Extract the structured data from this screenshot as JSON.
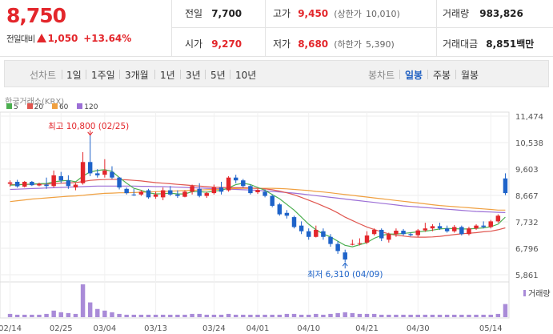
{
  "header": {
    "price": "8,750",
    "change_label": "전일대비",
    "change_amount": "1,050",
    "change_percent": "+13.64%"
  },
  "quote": {
    "prev_close": {
      "label": "전일",
      "value": "7,700"
    },
    "open": {
      "label": "시가",
      "value": "9,270"
    },
    "high": {
      "label": "고가",
      "value": "9,450",
      "sub_label": "(상한가",
      "sub_value": "10,010)"
    },
    "low": {
      "label": "저가",
      "value": "8,680",
      "sub_label": "(하한가",
      "sub_value": "5,390)"
    },
    "volume": {
      "label": "거래량",
      "value": "983,826"
    },
    "amount": {
      "label": "거래대금",
      "value": "8,851",
      "unit": "백만"
    }
  },
  "tabs": {
    "chart_type_label": "선차트",
    "periods": [
      "1일",
      "1주일",
      "3개월",
      "1년",
      "3년",
      "5년",
      "10년"
    ],
    "candle_label": "봉차트",
    "candles": [
      "일봉",
      "주봉",
      "월봉"
    ],
    "active_candle": "일봉"
  },
  "colors": {
    "up": "#e3262b",
    "down": "#1e63c9",
    "ma5": "#4caf50",
    "ma20": "#e0564f",
    "ma60": "#f0a040",
    "ma120": "#9c6fd6"
  },
  "chart_data": {
    "type": "candlestick",
    "title": "한국거래소(KRX)",
    "legend": [
      {
        "name": "5",
        "color": "#4caf50"
      },
      {
        "name": "20",
        "color": "#e0564f"
      },
      {
        "name": "60",
        "color": "#f0a040"
      },
      {
        "name": "120",
        "color": "#9c6fd6"
      }
    ],
    "yticks": [
      "11,474",
      "10,538",
      "9,603",
      "8,667",
      "7,732",
      "6,796",
      "5,861"
    ],
    "ylim": [
      5861,
      11474
    ],
    "xticks": [
      "02/14",
      "02/25",
      "03/04",
      "03/13",
      "03/24",
      "04/01",
      "04/10",
      "04/21",
      "04/30",
      "05/14"
    ],
    "high_annotation": "최고 10,800 (02/25)",
    "low_annotation": "최저 6,310 (04/09)",
    "volume_label": "거래량",
    "candles": [
      {
        "o": 9080,
        "h": 9200,
        "l": 8980,
        "c": 9130
      },
      {
        "o": 9150,
        "h": 9220,
        "l": 8940,
        "c": 8990
      },
      {
        "o": 8980,
        "h": 9180,
        "l": 8950,
        "c": 9150
      },
      {
        "o": 9150,
        "h": 9180,
        "l": 9000,
        "c": 9030
      },
      {
        "o": 9020,
        "h": 9120,
        "l": 8990,
        "c": 9080
      },
      {
        "o": 9050,
        "h": 9300,
        "l": 8900,
        "c": 9000
      },
      {
        "o": 9000,
        "h": 9550,
        "l": 8950,
        "c": 9380
      },
      {
        "o": 9350,
        "h": 9500,
        "l": 9100,
        "c": 9200
      },
      {
        "o": 9200,
        "h": 9380,
        "l": 8900,
        "c": 9000
      },
      {
        "o": 8950,
        "h": 9100,
        "l": 8850,
        "c": 9050
      },
      {
        "o": 9100,
        "h": 10200,
        "l": 9050,
        "c": 9850
      },
      {
        "o": 9850,
        "h": 10800,
        "l": 9350,
        "c": 9450
      },
      {
        "o": 9450,
        "h": 9600,
        "l": 9300,
        "c": 9380
      },
      {
        "o": 9400,
        "h": 9950,
        "l": 9300,
        "c": 9550
      },
      {
        "o": 9500,
        "h": 9700,
        "l": 9250,
        "c": 9300
      },
      {
        "o": 9300,
        "h": 9320,
        "l": 8880,
        "c": 8950
      },
      {
        "o": 8900,
        "h": 8950,
        "l": 8700,
        "c": 8750
      },
      {
        "o": 8700,
        "h": 8900,
        "l": 8650,
        "c": 8680
      },
      {
        "o": 8700,
        "h": 8850,
        "l": 8650,
        "c": 8800
      },
      {
        "o": 8850,
        "h": 8900,
        "l": 8550,
        "c": 8600
      },
      {
        "o": 8620,
        "h": 8800,
        "l": 8550,
        "c": 8700
      },
      {
        "o": 8600,
        "h": 8950,
        "l": 8500,
        "c": 8850
      },
      {
        "o": 8850,
        "h": 9000,
        "l": 8650,
        "c": 8700
      },
      {
        "o": 8700,
        "h": 8850,
        "l": 8580,
        "c": 8650
      },
      {
        "o": 8620,
        "h": 8850,
        "l": 8600,
        "c": 8800
      },
      {
        "o": 8800,
        "h": 9050,
        "l": 8700,
        "c": 9000
      },
      {
        "o": 8900,
        "h": 9100,
        "l": 8600,
        "c": 8650
      },
      {
        "o": 8650,
        "h": 8800,
        "l": 8580,
        "c": 8750
      },
      {
        "o": 8750,
        "h": 9050,
        "l": 8700,
        "c": 8950
      },
      {
        "o": 8950,
        "h": 9150,
        "l": 8700,
        "c": 8800
      },
      {
        "o": 8850,
        "h": 9350,
        "l": 8800,
        "c": 9300
      },
      {
        "o": 9300,
        "h": 9400,
        "l": 9100,
        "c": 9200
      },
      {
        "o": 9200,
        "h": 9250,
        "l": 8950,
        "c": 9000
      },
      {
        "o": 9000,
        "h": 9050,
        "l": 8700,
        "c": 8750
      },
      {
        "o": 8780,
        "h": 8900,
        "l": 8720,
        "c": 8860
      },
      {
        "o": 8800,
        "h": 8880,
        "l": 8600,
        "c": 8650
      },
      {
        "o": 8650,
        "h": 8700,
        "l": 8250,
        "c": 8300
      },
      {
        "o": 8350,
        "h": 8400,
        "l": 7950,
        "c": 8000
      },
      {
        "o": 8050,
        "h": 8150,
        "l": 7850,
        "c": 7950
      },
      {
        "o": 7900,
        "h": 7950,
        "l": 7500,
        "c": 7550
      },
      {
        "o": 7600,
        "h": 7750,
        "l": 7300,
        "c": 7400
      },
      {
        "o": 7400,
        "h": 7500,
        "l": 7100,
        "c": 7200
      },
      {
        "o": 7200,
        "h": 7600,
        "l": 7180,
        "c": 7450
      },
      {
        "o": 7400,
        "h": 7500,
        "l": 7100,
        "c": 7200
      },
      {
        "o": 7200,
        "h": 7300,
        "l": 6850,
        "c": 6950
      },
      {
        "o": 6950,
        "h": 7050,
        "l": 6600,
        "c": 6700
      },
      {
        "o": 6650,
        "h": 6750,
        "l": 6310,
        "c": 6400
      },
      {
        "o": 6950,
        "h": 7100,
        "l": 6900,
        "c": 6950
      },
      {
        "o": 6980,
        "h": 7150,
        "l": 6900,
        "c": 6980
      },
      {
        "o": 7000,
        "h": 7400,
        "l": 6950,
        "c": 7250
      },
      {
        "o": 7300,
        "h": 7500,
        "l": 7250,
        "c": 7450
      },
      {
        "o": 7450,
        "h": 7500,
        "l": 7050,
        "c": 7150
      },
      {
        "o": 7100,
        "h": 7350,
        "l": 7000,
        "c": 7300
      },
      {
        "o": 7300,
        "h": 7500,
        "l": 7200,
        "c": 7420
      },
      {
        "o": 7420,
        "h": 7480,
        "l": 7250,
        "c": 7300
      },
      {
        "o": 7300,
        "h": 7350,
        "l": 7220,
        "c": 7260
      },
      {
        "o": 7260,
        "h": 7480,
        "l": 7200,
        "c": 7430
      },
      {
        "o": 7430,
        "h": 7700,
        "l": 7380,
        "c": 7500
      },
      {
        "o": 7500,
        "h": 7650,
        "l": 7400,
        "c": 7580
      },
      {
        "o": 7580,
        "h": 7700,
        "l": 7450,
        "c": 7500
      },
      {
        "o": 7500,
        "h": 7600,
        "l": 7350,
        "c": 7400
      },
      {
        "o": 7400,
        "h": 7620,
        "l": 7350,
        "c": 7550
      },
      {
        "o": 7550,
        "h": 7600,
        "l": 7250,
        "c": 7300
      },
      {
        "o": 7300,
        "h": 7560,
        "l": 7250,
        "c": 7500
      },
      {
        "o": 7500,
        "h": 7650,
        "l": 7450,
        "c": 7600
      },
      {
        "o": 7600,
        "h": 7750,
        "l": 7500,
        "c": 7550
      },
      {
        "o": 7550,
        "h": 7800,
        "l": 7500,
        "c": 7750
      },
      {
        "o": 7750,
        "h": 8000,
        "l": 7700,
        "c": 7950
      },
      {
        "o": 9270,
        "h": 9450,
        "l": 8680,
        "c": 8750
      }
    ],
    "volume": [
      4,
      3,
      3,
      3,
      3,
      4,
      8,
      6,
      5,
      4,
      40,
      18,
      10,
      8,
      6,
      4,
      3,
      3,
      3,
      3,
      3,
      3,
      3,
      3,
      3,
      4,
      4,
      3,
      3,
      3,
      4,
      3,
      3,
      3,
      3,
      3,
      3,
      3,
      4,
      4,
      3,
      3,
      4,
      3,
      4,
      5,
      6,
      5,
      4,
      4,
      4,
      3,
      3,
      3,
      3,
      3,
      3,
      3,
      3,
      3,
      3,
      3,
      3,
      3,
      3,
      3,
      3,
      4,
      16
    ],
    "ma5": [
      9030,
      9040,
      9060,
      9070,
      9080,
      9090,
      9150,
      9180,
      9200,
      9150,
      9350,
      9500,
      9550,
      9580,
      9520,
      9300,
      9100,
      8920,
      8850,
      8760,
      8720,
      8730,
      8750,
      8720,
      8720,
      8800,
      8800,
      8780,
      8820,
      8850,
      8930,
      9050,
      9100,
      9050,
      8950,
      8850,
      8700,
      8550,
      8350,
      8150,
      7900,
      7650,
      7450,
      7300,
      7200,
      7050,
      6900,
      6850,
      6920,
      7000,
      7150,
      7250,
      7300,
      7300,
      7320,
      7350,
      7380,
      7400,
      7440,
      7480,
      7500,
      7490,
      7480,
      7480,
      7500,
      7520,
      7560,
      7650,
      7900
    ],
    "ma20": [
      9050,
      9050,
      9060,
      9060,
      9070,
      9070,
      9080,
      9100,
      9110,
      9120,
      9160,
      9200,
      9220,
      9230,
      9240,
      9230,
      9220,
      9200,
      9180,
      9150,
      9120,
      9100,
      9080,
      9060,
      9040,
      9020,
      9000,
      8980,
      8960,
      8950,
      8940,
      8940,
      8940,
      8930,
      8920,
      8900,
      8870,
      8820,
      8760,
      8690,
      8600,
      8500,
      8400,
      8290,
      8180,
      8050,
      7900,
      7780,
      7660,
      7550,
      7460,
      7380,
      7310,
      7260,
      7230,
      7200,
      7190,
      7190,
      7200,
      7220,
      7250,
      7280,
      7310,
      7330,
      7350,
      7380,
      7400,
      7450,
      7520
    ],
    "ma60": [
      8450,
      8480,
      8510,
      8540,
      8560,
      8580,
      8600,
      8620,
      8640,
      8650,
      8670,
      8700,
      8720,
      8740,
      8750,
      8760,
      8760,
      8770,
      8780,
      8790,
      8800,
      8810,
      8820,
      8830,
      8840,
      8850,
      8860,
      8870,
      8880,
      8890,
      8900,
      8910,
      8920,
      8920,
      8920,
      8920,
      8920,
      8910,
      8900,
      8880,
      8860,
      8840,
      8810,
      8790,
      8760,
      8730,
      8700,
      8670,
      8640,
      8610,
      8580,
      8550,
      8520,
      8490,
      8460,
      8430,
      8400,
      8370,
      8340,
      8310,
      8290,
      8270,
      8250,
      8230,
      8210,
      8190,
      8170,
      8150,
      8150
    ],
    "ma120": [
      8880,
      8890,
      8900,
      8910,
      8920,
      8930,
      8940,
      8950,
      8960,
      8970,
      8980,
      8990,
      9000,
      9000,
      9000,
      9000,
      9000,
      9000,
      8990,
      8990,
      8980,
      8980,
      8970,
      8960,
      8950,
      8940,
      8930,
      8920,
      8910,
      8900,
      8890,
      8880,
      8870,
      8860,
      8850,
      8830,
      8810,
      8790,
      8770,
      8750,
      8720,
      8690,
      8660,
      8630,
      8600,
      8570,
      8540,
      8510,
      8480,
      8450,
      8420,
      8390,
      8360,
      8330,
      8300,
      8280,
      8260,
      8240,
      8220,
      8200,
      8180,
      8160,
      8140,
      8120,
      8100,
      8090,
      8080,
      8070,
      8060
    ]
  }
}
